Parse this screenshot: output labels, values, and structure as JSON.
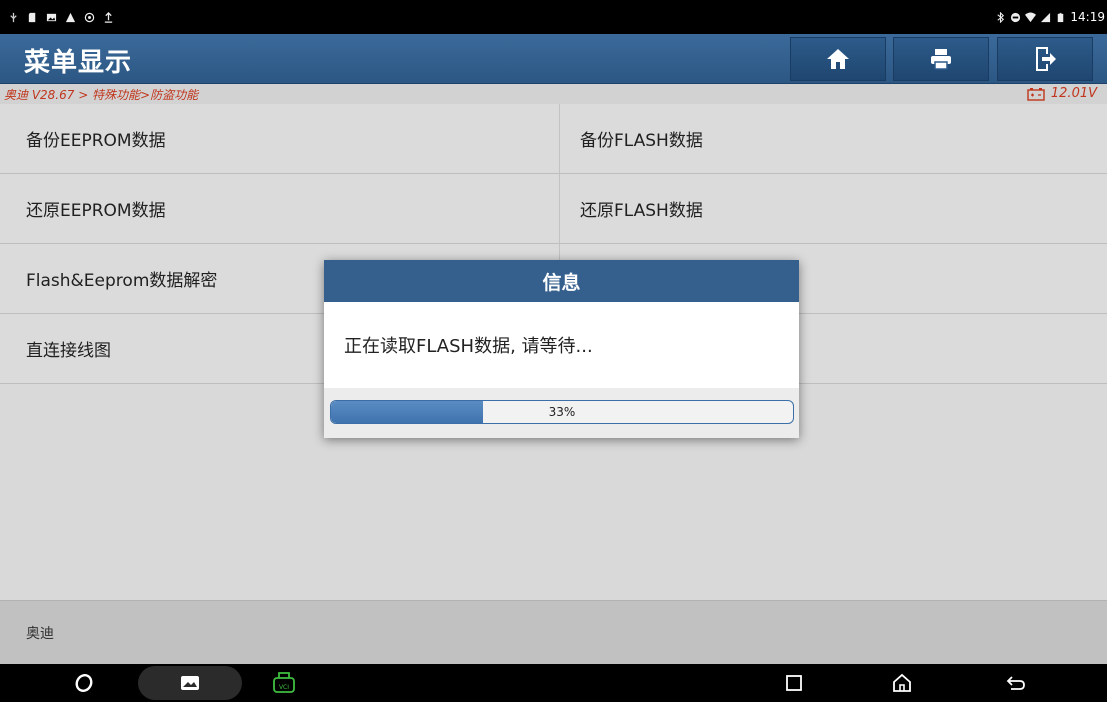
{
  "status_bar": {
    "left_icons": [
      "usb-icon",
      "sd-card-icon",
      "image-icon",
      "warning-icon",
      "gear-icon",
      "upload-icon"
    ],
    "right_icons": [
      "bluetooth-icon",
      "dnd-icon",
      "wifi-icon",
      "signal-icon",
      "battery-icon"
    ],
    "time": "14:19"
  },
  "header": {
    "title": "菜单显示",
    "buttons": [
      "home-icon",
      "print-icon",
      "exit-icon"
    ]
  },
  "breadcrumb": {
    "path": "奥迪 V28.67 > 特殊功能>防盗功能",
    "voltage": "12.01V"
  },
  "menu": {
    "items": [
      {
        "label": "备份EEPROM数据"
      },
      {
        "label": "备份FLASH数据"
      },
      {
        "label": "还原EEPROM数据"
      },
      {
        "label": "还原FLASH数据"
      },
      {
        "label": "Flash&Eeprom数据解密"
      },
      {
        "label": "直连接线图"
      }
    ]
  },
  "footer": {
    "label": "奥迪"
  },
  "dialog": {
    "title": "信息",
    "message": "正在读取FLASH数据, 请等待...",
    "progress_text": "33%",
    "progress_value": 0.33
  },
  "navbar": {
    "icons": [
      "browser-icon",
      "gallery-icon",
      "vci-icon",
      "recents-icon",
      "home-nav-icon",
      "back-icon"
    ]
  },
  "colors": {
    "header_blue": "#35608e",
    "breadcrumb_red": "#c8371d",
    "progress_fill": "#4a7fba",
    "vci_green": "#3fbf3f"
  }
}
